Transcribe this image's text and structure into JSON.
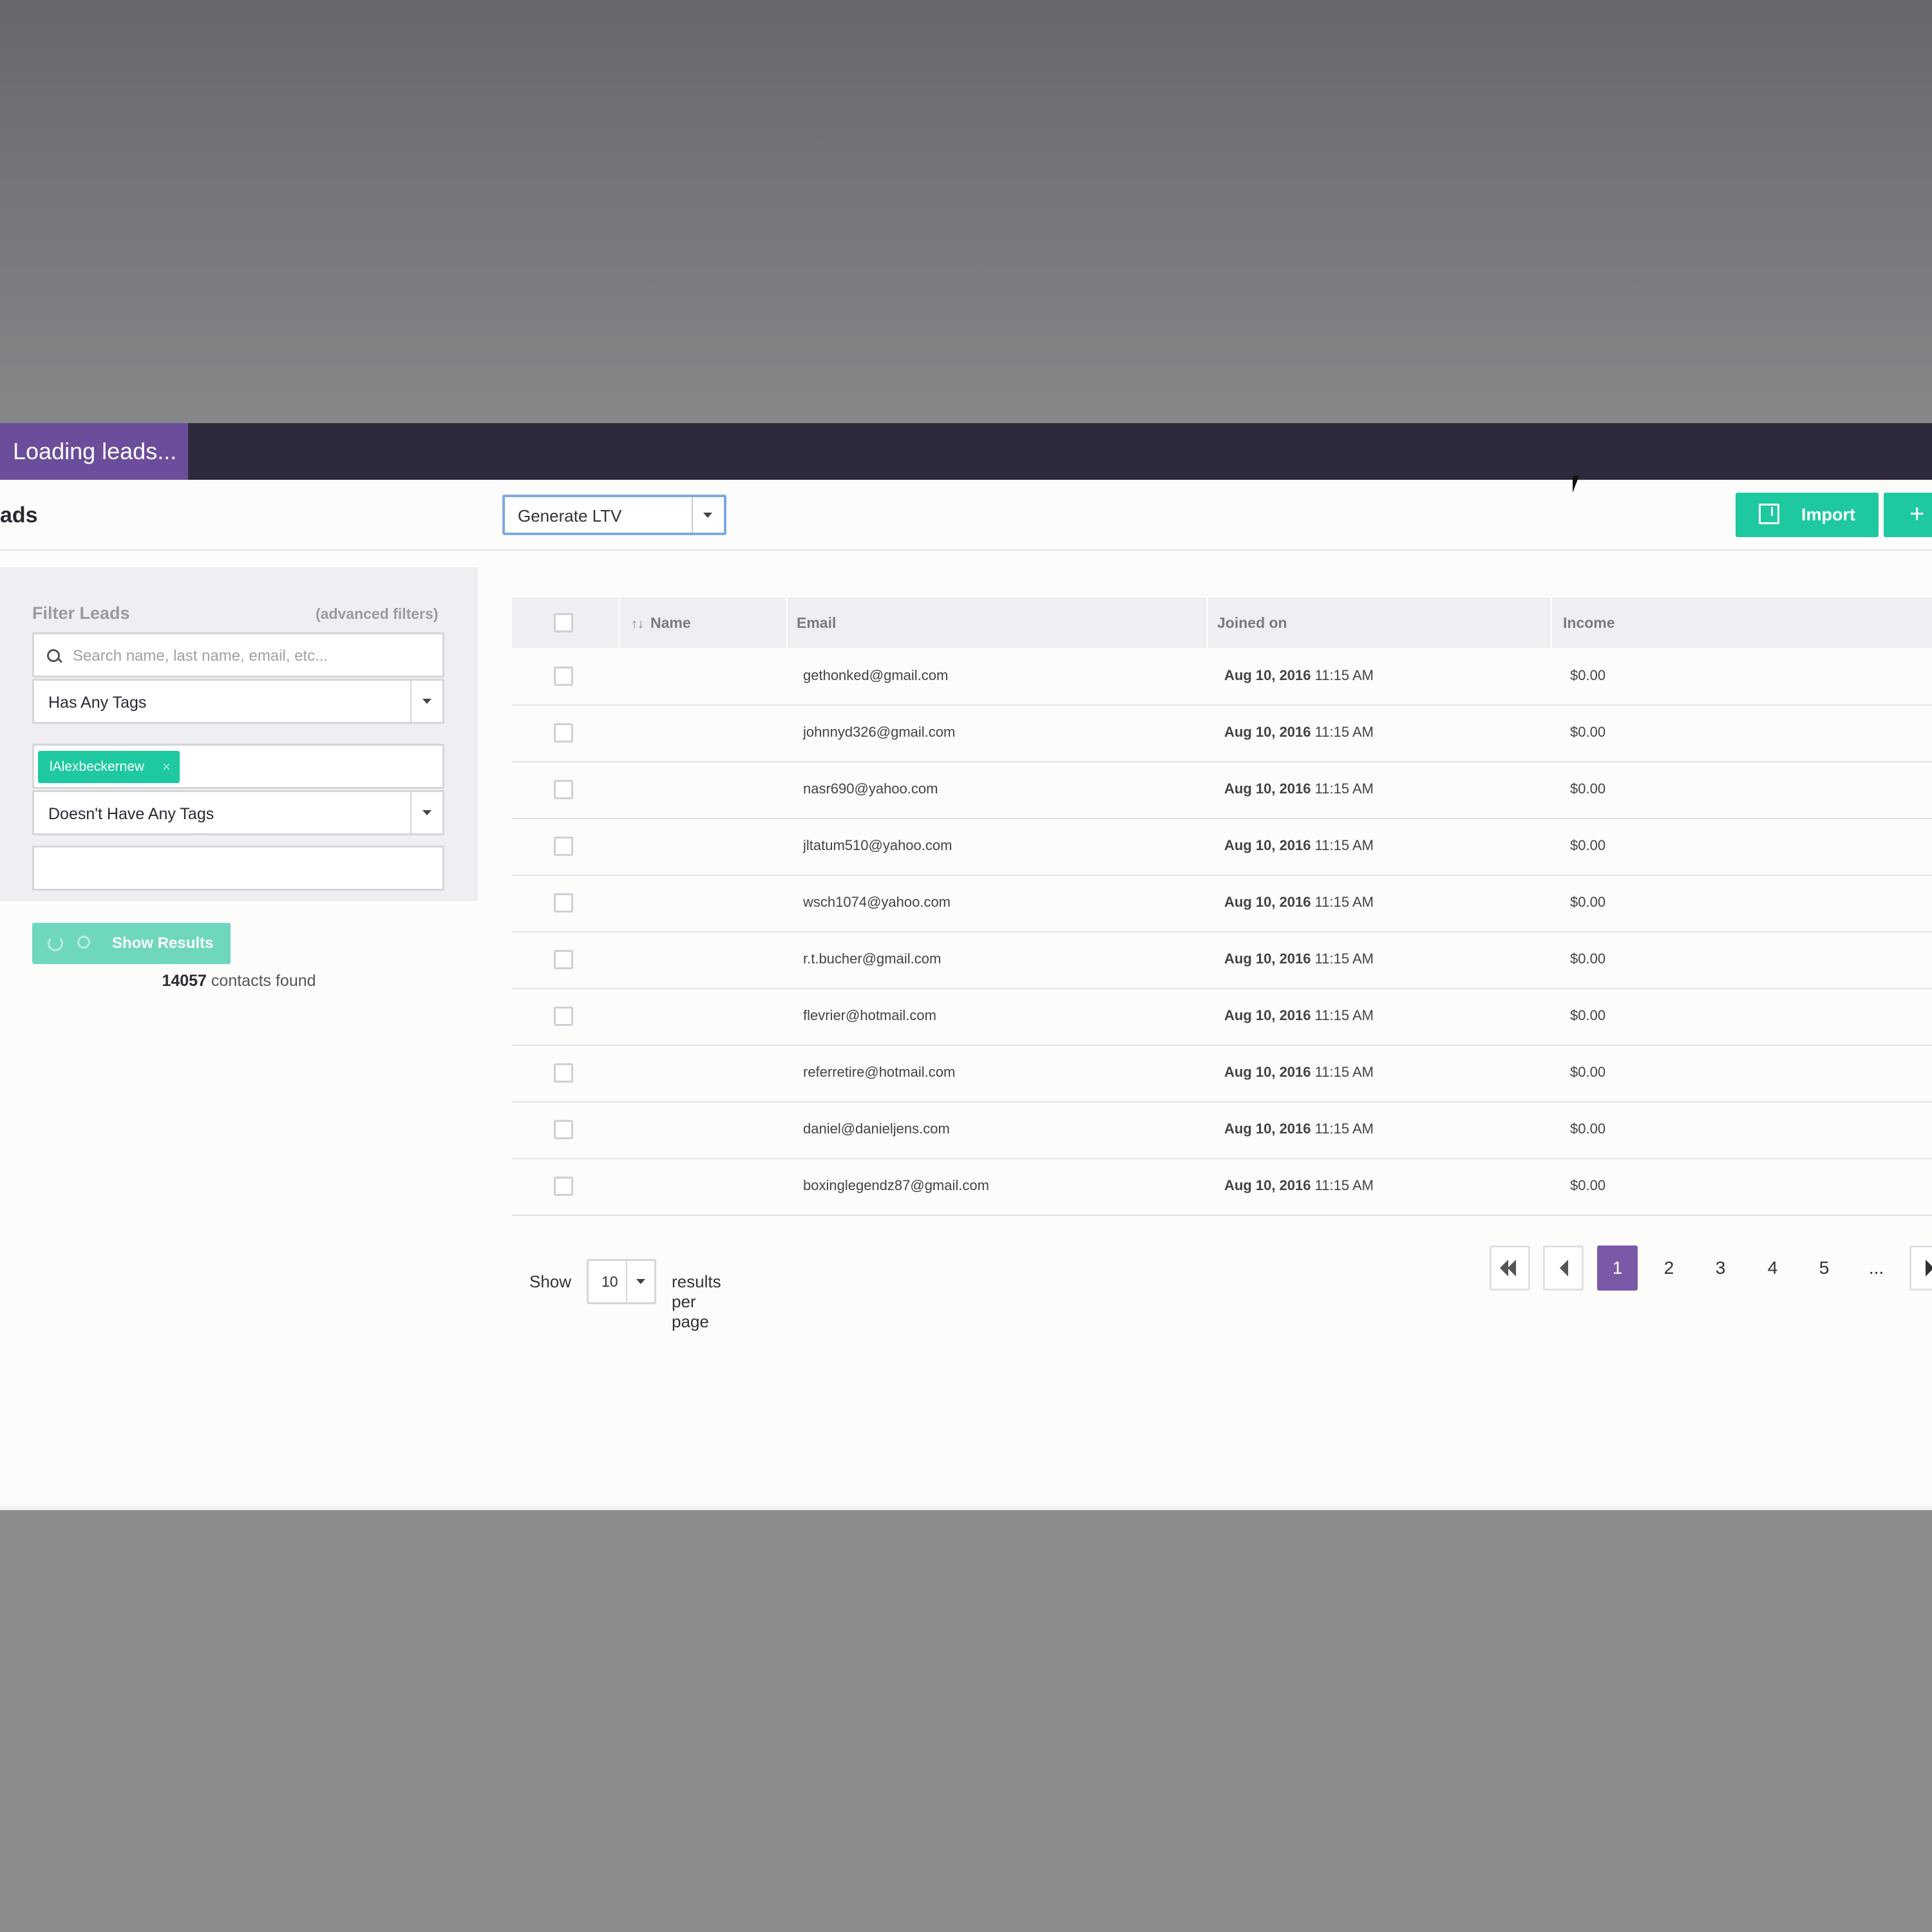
{
  "topbar": {
    "loading_text": "Loading leads..."
  },
  "header": {
    "title": "ads",
    "ltv_select": "Generate LTV",
    "import_label": "Import",
    "add_label": "+"
  },
  "filter": {
    "title": "Filter Leads",
    "advanced_link": "(advanced filters)",
    "search_placeholder": "Search name, last name, email, etc...",
    "has_tags_select": "Has Any Tags",
    "tag_chip": "lAlexbeckernew",
    "tag_remove": "×",
    "not_tags_select": "Doesn't Have Any Tags",
    "show_results_label": "Show Results",
    "contacts_count": "14057",
    "contacts_suffix": "contacts found"
  },
  "table": {
    "columns": {
      "name": "Name",
      "email": "Email",
      "joined": "Joined on",
      "income": "Income",
      "sort_icon": "↑↓"
    },
    "rows": [
      {
        "email": "gethonked@gmail.com",
        "date": "Aug 10, 2016",
        "time": "11:15 AM",
        "income": "$0.00"
      },
      {
        "email": "johnnyd326@gmail.com",
        "date": "Aug 10, 2016",
        "time": "11:15 AM",
        "income": "$0.00"
      },
      {
        "email": "nasr690@yahoo.com",
        "date": "Aug 10, 2016",
        "time": "11:15 AM",
        "income": "$0.00"
      },
      {
        "email": "jltatum510@yahoo.com",
        "date": "Aug 10, 2016",
        "time": "11:15 AM",
        "income": "$0.00"
      },
      {
        "email": "wsch1074@yahoo.com",
        "date": "Aug 10, 2016",
        "time": "11:15 AM",
        "income": "$0.00"
      },
      {
        "email": "r.t.bucher@gmail.com",
        "date": "Aug 10, 2016",
        "time": "11:15 AM",
        "income": "$0.00"
      },
      {
        "email": "flevrier@hotmail.com",
        "date": "Aug 10, 2016",
        "time": "11:15 AM",
        "income": "$0.00"
      },
      {
        "email": "referretire@hotmail.com",
        "date": "Aug 10, 2016",
        "time": "11:15 AM",
        "income": "$0.00"
      },
      {
        "email": "daniel@danieljens.com",
        "date": "Aug 10, 2016",
        "time": "11:15 AM",
        "income": "$0.00"
      },
      {
        "email": "boxinglegendz87@gmail.com",
        "date": "Aug 10, 2016",
        "time": "11:15 AM",
        "income": "$0.00"
      }
    ]
  },
  "pagination": {
    "show_label": "Show",
    "per_page_value": "10",
    "per_page_suffix": "results per page",
    "pages": [
      "1",
      "2",
      "3",
      "4",
      "5"
    ],
    "ellipsis": "...",
    "current_page": "1"
  },
  "colors": {
    "topbar": "#2e2a3b",
    "loading_badge": "#6b4e9b",
    "accent_green": "#1ec9a0",
    "active_page": "#7a5aa8"
  },
  "icons": [
    "search-icon",
    "chevron-down-icon",
    "import-icon",
    "plus-icon",
    "sort-icon",
    "spinner-icon",
    "first-page-icon",
    "prev-page-icon",
    "next-page-icon",
    "close-icon"
  ]
}
